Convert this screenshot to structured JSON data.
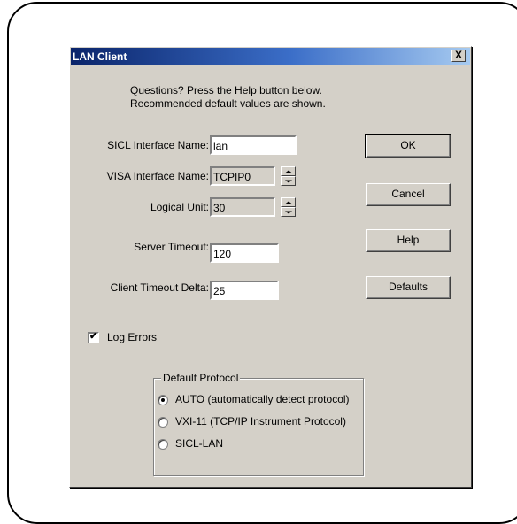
{
  "dialog": {
    "title": "LAN Client",
    "close_glyph": "X"
  },
  "info": {
    "line1": "Questions?  Press the Help button below.",
    "line2": "Recommended default values are shown."
  },
  "fields": {
    "sicl": {
      "label": "SICL Interface Name:",
      "value": "lan"
    },
    "visa": {
      "label": "VISA Interface Name:",
      "value": "TCPIP0"
    },
    "logical_unit": {
      "label": "Logical Unit:",
      "value": "30"
    },
    "server_timeout": {
      "label": "Server Timeout:",
      "value": "120"
    },
    "client_timeout": {
      "label": "Client Timeout Delta:",
      "value": "25"
    }
  },
  "buttons": {
    "ok": "OK",
    "cancel": "Cancel",
    "help": "Help",
    "defaults": "Defaults"
  },
  "log_errors": {
    "label": "Log Errors",
    "checked": true,
    "check_glyph": "✔"
  },
  "protocol": {
    "legend": "Default Protocol",
    "options": [
      {
        "label": "AUTO (automatically detect protocol)",
        "selected": true
      },
      {
        "label": "VXI-11 (TCP/IP Instrument Protocol)",
        "selected": false
      },
      {
        "label": "SICL-LAN",
        "selected": false
      }
    ]
  },
  "colors": {
    "dialog_face": "#d4d0c8",
    "title_start": "#0a246a",
    "title_end": "#a6caf0"
  }
}
